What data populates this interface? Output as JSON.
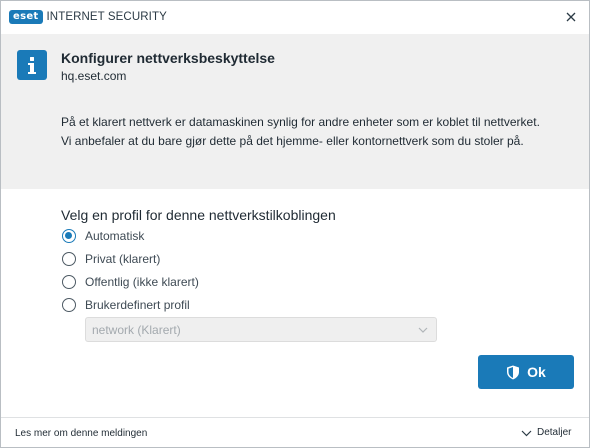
{
  "titlebar": {
    "logo_badge": "eset",
    "logo_text": "INTERNET SECURITY"
  },
  "header": {
    "title": "Konfigurer nettverksbeskyttelse",
    "subtitle": "hq.eset.com",
    "description": "På et klarert nettverk er datamaskinen synlig for andre enheter som er koblet til nettverket. Vi anbefaler at du bare gjør dette på det hjemme- eller kontornettverk som du stoler på."
  },
  "profile": {
    "label": "Velg en profil for denne nettverkstilkoblingen",
    "options": [
      {
        "label": "Automatisk",
        "checked": true
      },
      {
        "label": "Privat (klarert)",
        "checked": false
      },
      {
        "label": "Offentlig (ikke klarert)",
        "checked": false
      },
      {
        "label": "Brukerdefinert profil",
        "checked": false
      }
    ],
    "select_value": "network (Klarert)"
  },
  "actions": {
    "ok_label": "Ok"
  },
  "footer": {
    "link": "Les mer om denne meldingen",
    "details": "Detaljer"
  },
  "colors": {
    "accent": "#1a7ab8",
    "header_bg": "#f0f0f0"
  },
  "icons": {
    "close": "close-icon",
    "info": "info-icon",
    "shield": "shield-icon",
    "select_chevron": "chevron-down-icon",
    "details_chevron": "chevron-down-icon"
  }
}
